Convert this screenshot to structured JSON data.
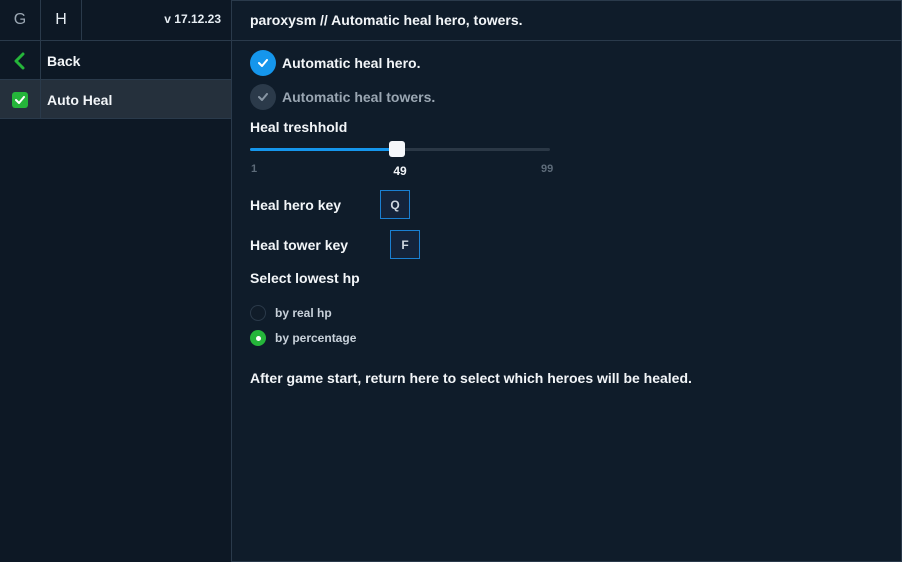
{
  "sidebar": {
    "tabs": [
      {
        "label": "G"
      },
      {
        "label": "H"
      }
    ],
    "version": "v 17.12.23",
    "items": [
      {
        "label": "Back",
        "icon": "chevron-left-icon"
      },
      {
        "label": "Auto Heal",
        "icon": "checkbox-checked-icon"
      }
    ]
  },
  "header": {
    "title": "paroxysm // Automatic heal hero, towers."
  },
  "main": {
    "toggles": [
      {
        "label": "Automatic heal hero.",
        "checked": true
      },
      {
        "label": "Automatic heal towers.",
        "checked": false
      }
    ],
    "slider": {
      "label": "Heal treshhold",
      "min": "1",
      "max": "99",
      "value": "49"
    },
    "keys": [
      {
        "label": "Heal hero key",
        "key": "Q"
      },
      {
        "label": "Heal tower key",
        "key": "F"
      }
    ],
    "radio_group": {
      "label": "Select lowest hp",
      "options": [
        {
          "label": "by real hp",
          "selected": false
        },
        {
          "label": "by percentage",
          "selected": true
        }
      ]
    },
    "note": "After game start, return here to select which heroes will be healed."
  },
  "colors": {
    "background": "#0f1c2a",
    "accent_blue": "#1596ec",
    "accent_green": "#25b53a",
    "border": "#2a3a4b"
  }
}
